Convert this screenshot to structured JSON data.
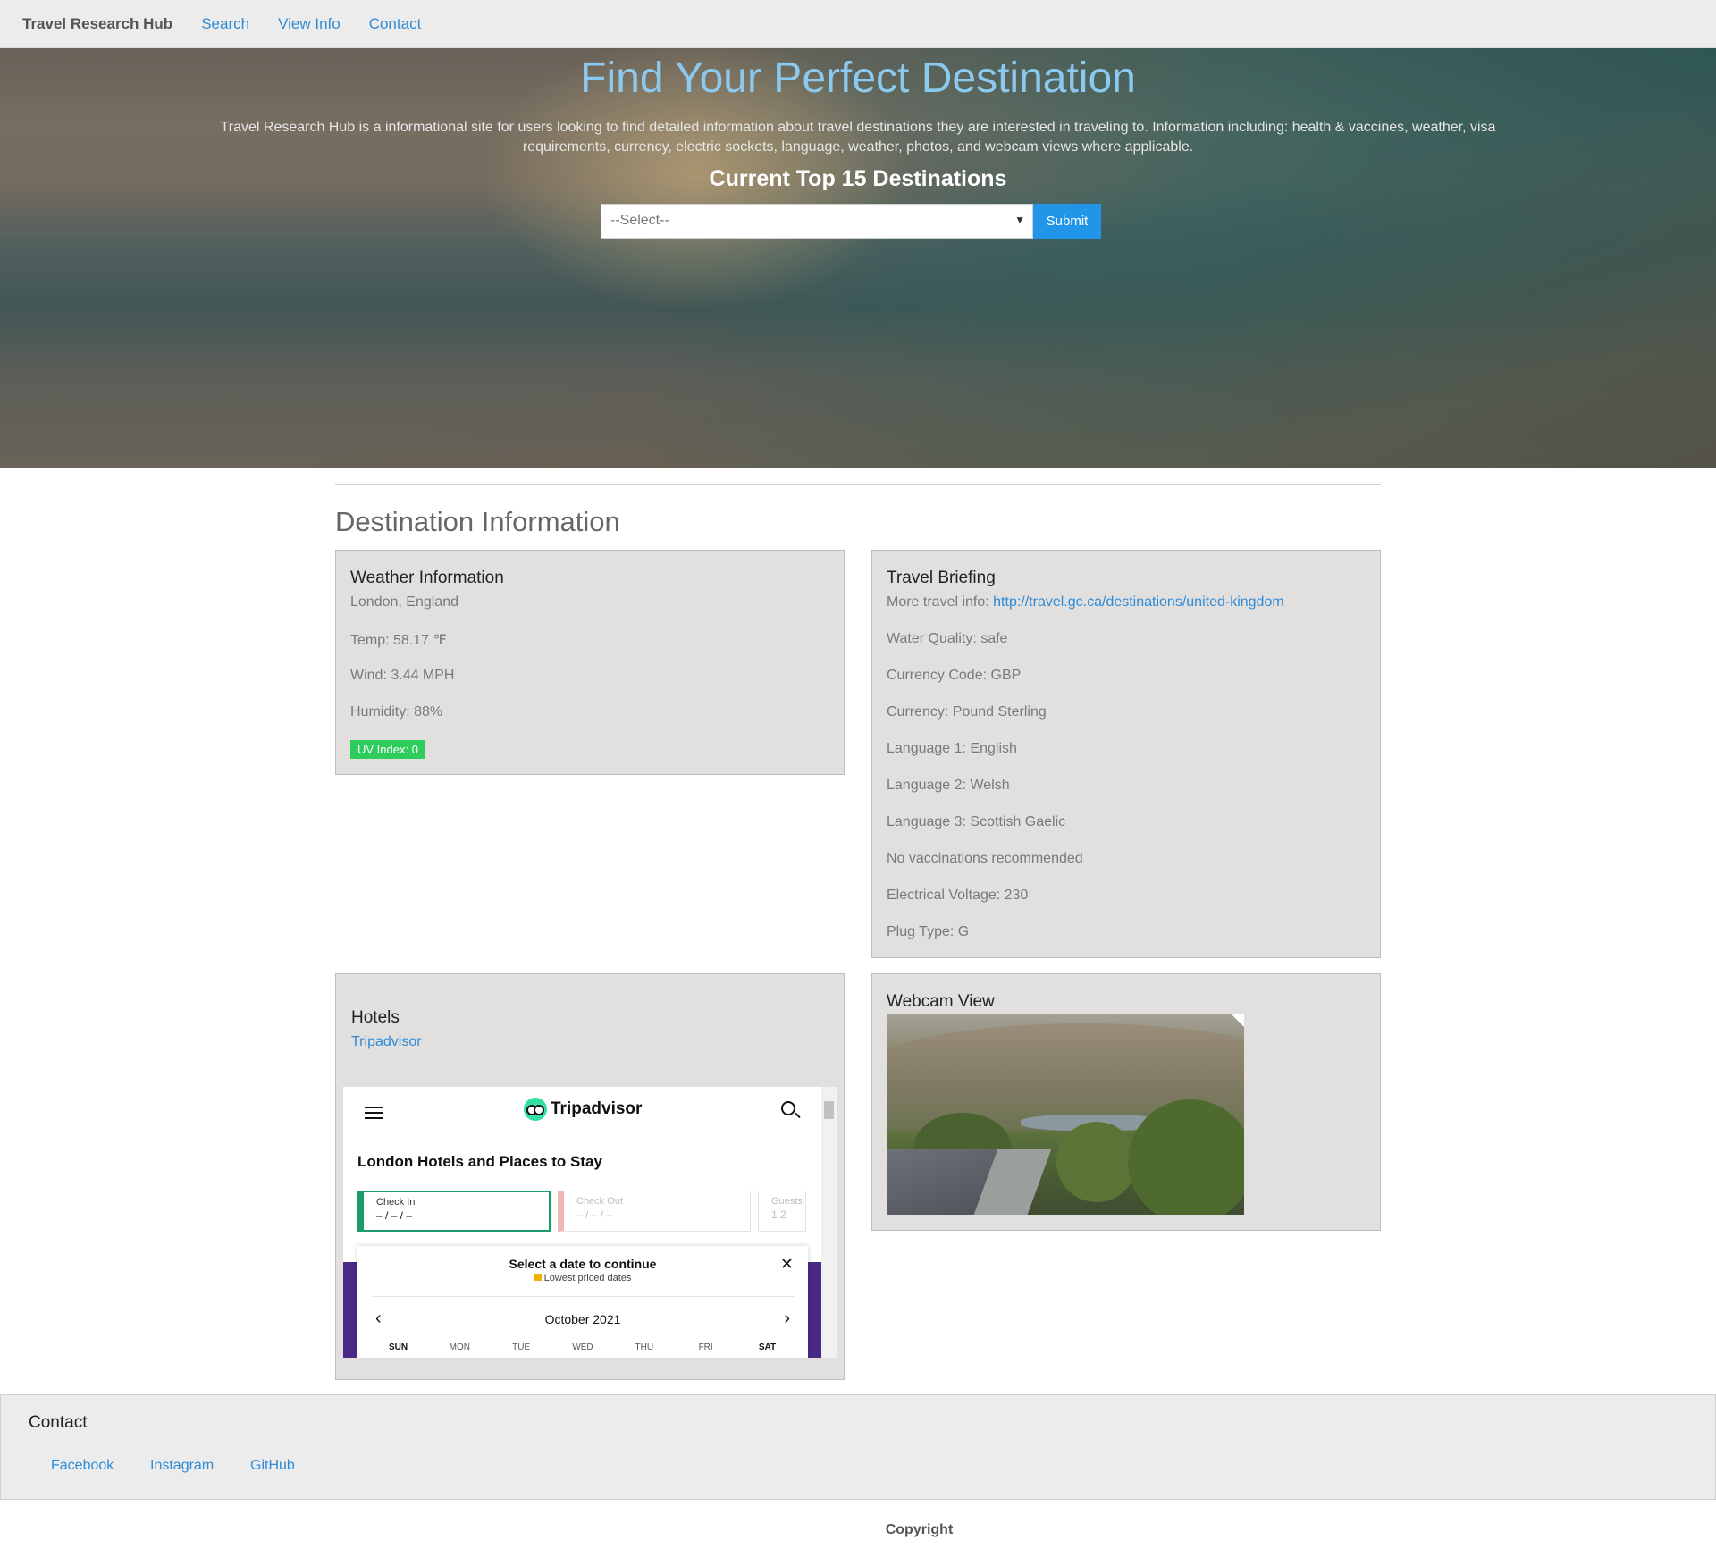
{
  "nav": {
    "brand": "Travel Research Hub",
    "links": [
      "Search",
      "View Info",
      "Contact"
    ]
  },
  "hero": {
    "title": "Find Your Perfect Destination",
    "description_line1": "Travel Research Hub is a informational site for users looking to find detailed information about travel destinations they are interested in traveling to. Information including: health & vaccines, weather, visa",
    "description_line2": "requirements, currency, electric sockets, language, weather, photos, and webcam views where applicable.",
    "subtitle": "Current Top 15 Destinations",
    "select_value": "--Select--",
    "submit_label": "Submit"
  },
  "section_title": "Destination Information",
  "weather": {
    "title": "Weather Information",
    "location": "London, England",
    "temp": "Temp: 58.17 ℉",
    "wind": "Wind: 3.44 MPH",
    "humidity": "Humidity: 88%",
    "uv": "UV Index: 0",
    "uv_color": "#2ecc5c"
  },
  "briefing": {
    "title": "Travel Briefing",
    "more_info_label": "More travel info: ",
    "more_info_link": "http://travel.gc.ca/destinations/united-kingdom",
    "rows": [
      "Water Quality: safe",
      "Currency Code: GBP",
      "Currency: Pound Sterling",
      "Language 1: English",
      "Language 2: Welsh",
      "Language 3: Scottish Gaelic",
      "No vaccinations recommended",
      "Electrical Voltage: 230",
      "Plug Type: G"
    ]
  },
  "hotels": {
    "title": "Hotels",
    "link": "Tripadvisor",
    "embed": {
      "brand": "Tripadvisor",
      "heading": "London Hotels and Places to Stay",
      "check_in_label": "Check In",
      "check_in_value": "– / – / –",
      "check_out_label": "Check Out",
      "check_out_value": "– / – / –",
      "guests_label": "Guests",
      "guests_value": "1  2",
      "popup_title": "Select a date to continue",
      "popup_sub": "Lowest priced dates",
      "close": "✕",
      "month": "October 2021",
      "prev": "‹",
      "next": "›",
      "days": [
        "SUN",
        "MON",
        "TUE",
        "WED",
        "THU",
        "FRI",
        "SAT"
      ]
    }
  },
  "webcam": {
    "title": "Webcam View"
  },
  "footer": {
    "title": "Contact",
    "links": [
      "Facebook",
      "Instagram",
      "GitHub"
    ],
    "copyright": "Copyright"
  },
  "colors": {
    "accent": "#2196e8",
    "link": "#2f8bd6",
    "title_blue": "#8cc9ee"
  }
}
